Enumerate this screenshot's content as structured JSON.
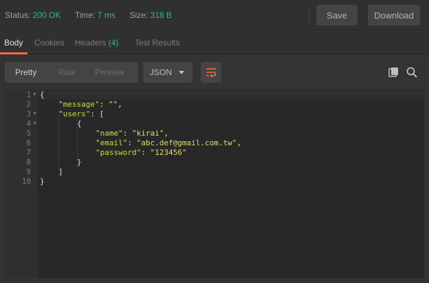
{
  "status": {
    "status_label": "Status:",
    "status_value": "200 OK",
    "time_label": "Time:",
    "time_value": "7 ms",
    "size_label": "Size:",
    "size_value": "318 B",
    "save_label": "Save",
    "download_label": "Download"
  },
  "tabs": {
    "body": "Body",
    "cookies": "Cookies",
    "headers": "Headers",
    "headers_count": "(4)",
    "test_results": "Test Results"
  },
  "toolbar": {
    "pretty": "Pretty",
    "raw": "Raw",
    "preview": "Preview",
    "format": "JSON",
    "icons": [
      "wrap-lines-icon",
      "copy-icon",
      "search-icon"
    ]
  },
  "editor": {
    "line_numbers": [
      "1",
      "2",
      "3",
      "4",
      "5",
      "6",
      "7",
      "8",
      "9",
      "10"
    ],
    "lines": {
      "l1": "{",
      "l2_key": "\"message\"",
      "l2_rest": ": ",
      "l2_val": "\"\"",
      "l2_end": ",",
      "l3_key": "\"users\"",
      "l3_rest": ": [",
      "l4": "{",
      "l5_key": "\"name\"",
      "l5_rest": ": ",
      "l5_val": "\"kirai\"",
      "l5_end": ",",
      "l6_key": "\"email\"",
      "l6_rest": ": ",
      "l6_val": "\"abc.def@gmail.com.tw\"",
      "l6_end": ",",
      "l7_key": "\"password\"",
      "l7_rest": ": ",
      "l7_val": "\"123456\"",
      "l8": "}",
      "l9": "]",
      "l10": "}"
    }
  },
  "colors": {
    "accent": "#f26b3a",
    "status_ok": "#2fbf71",
    "json_key": "#c1e03b",
    "json_string": "#e6db74"
  }
}
